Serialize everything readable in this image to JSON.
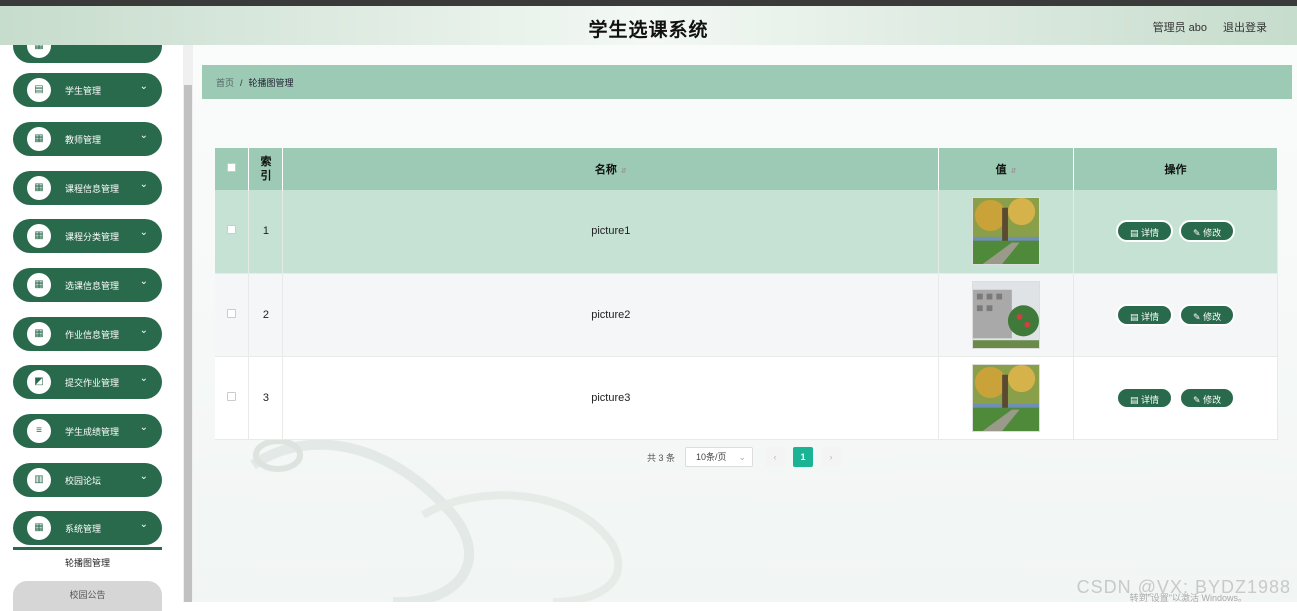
{
  "header": {
    "title": "学生选课系统",
    "user": "管理员 abo",
    "logout": "退出登录"
  },
  "sidebar": {
    "items": [
      {
        "label": "学生管理",
        "icon": "id-card-icon",
        "glyph": "🪪"
      },
      {
        "label": "教师管理",
        "icon": "grid-icon",
        "glyph": "▦"
      },
      {
        "label": "课程信息管理",
        "icon": "grid-icon",
        "glyph": "▦"
      },
      {
        "label": "课程分类管理",
        "icon": "grid-icon",
        "glyph": "▦"
      },
      {
        "label": "选课信息管理",
        "icon": "grid-icon",
        "glyph": "▦"
      },
      {
        "label": "作业信息管理",
        "icon": "grid-icon",
        "glyph": "▦"
      },
      {
        "label": "提交作业管理",
        "icon": "chart-icon",
        "glyph": "▤"
      },
      {
        "label": "学生成绩管理",
        "icon": "list-icon",
        "glyph": "≡"
      },
      {
        "label": "校园论坛",
        "icon": "bar-chart-icon",
        "glyph": "▥"
      },
      {
        "label": "系统管理",
        "icon": "grid-icon",
        "glyph": "▦"
      }
    ],
    "sub_active": "轮播图管理",
    "sub_item": "校园公告"
  },
  "breadcrumb": {
    "home": "首页",
    "current": "轮播图管理"
  },
  "table": {
    "headers": {
      "index": "索引",
      "name": "名称",
      "value": "值",
      "actions": "操作"
    },
    "rows": [
      {
        "index": "1",
        "name": "picture1",
        "image": "autumn-campus-photo"
      },
      {
        "index": "2",
        "name": "picture2",
        "image": "building-photo"
      },
      {
        "index": "3",
        "name": "picture3",
        "image": "autumn-campus-photo"
      }
    ],
    "detail_label": "详情",
    "edit_label": "修改"
  },
  "pager": {
    "total": "共 3 条",
    "page_size": "10条/页",
    "current_page": "1",
    "prev": "‹",
    "next": "›"
  },
  "watermark": {
    "text": "CSDN @VX: BYDZ1988",
    "activate": "转到\"设置\"以激活 Windows。"
  },
  "colors": {
    "accent": "#2a6a4c",
    "header_row": "#9ccab4",
    "pager_active": "#1ab394"
  }
}
